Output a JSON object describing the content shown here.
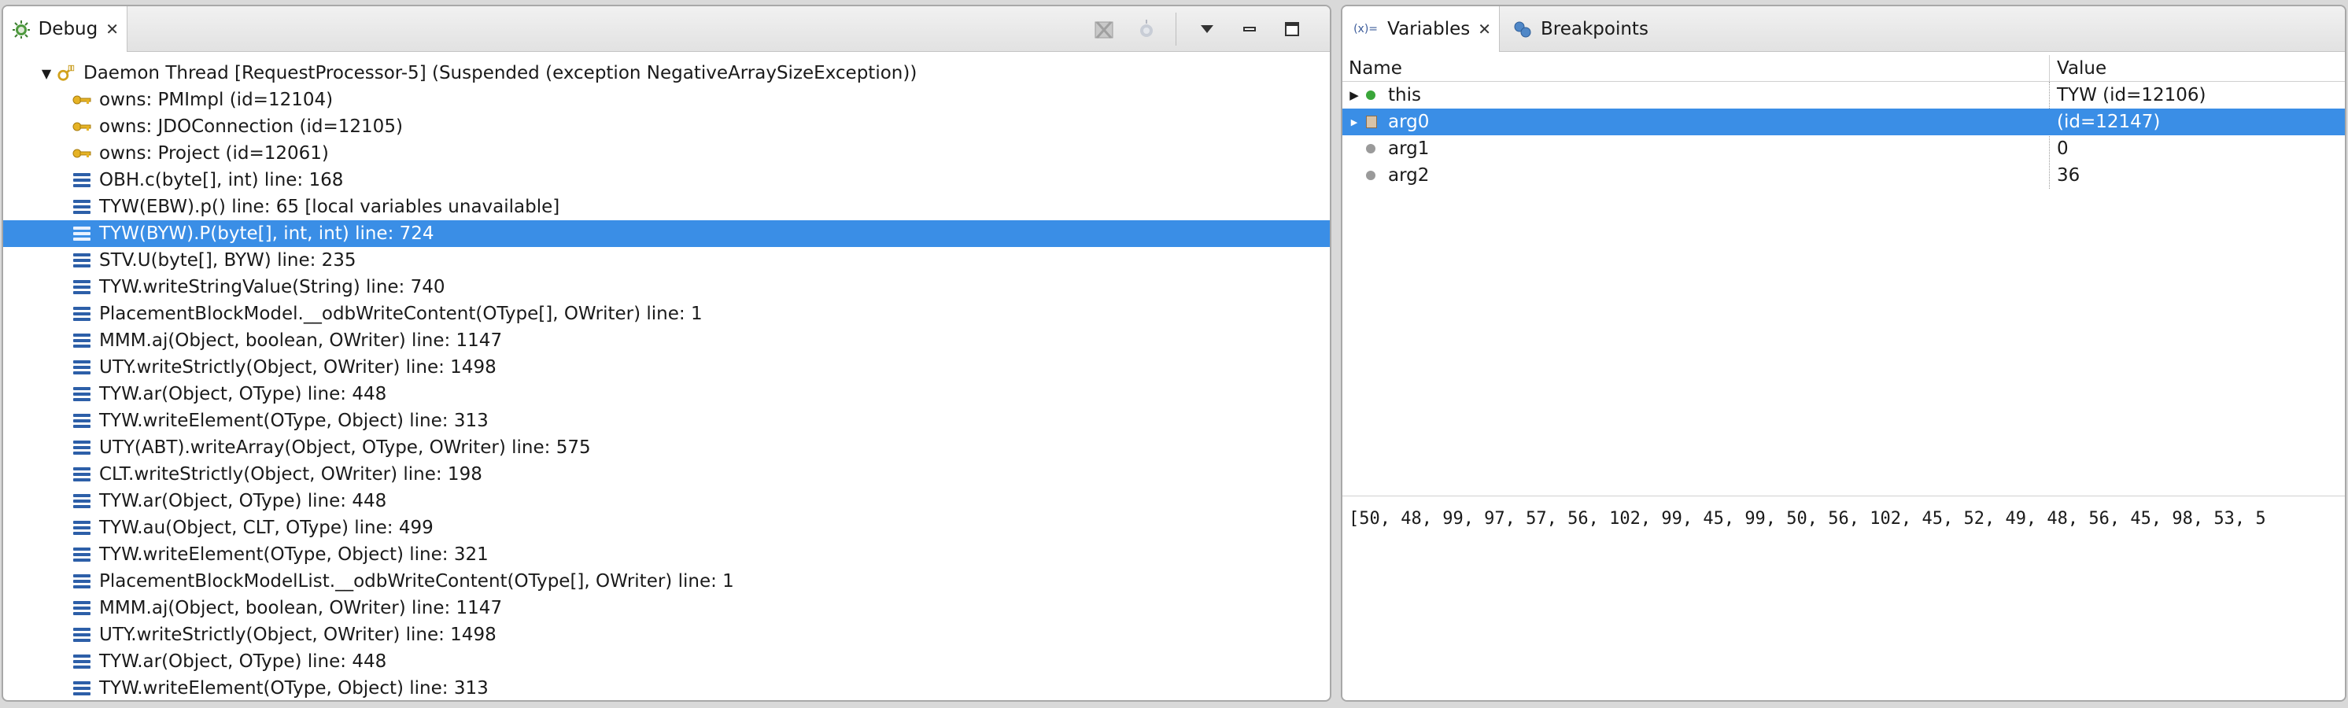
{
  "debug": {
    "tab_label": "Debug",
    "close_glyph": "✕",
    "tree": {
      "thread": "Daemon Thread [RequestProcessor-5] (Suspended (exception NegativeArraySizeException))",
      "monitors": [
        "owns: PMImpl  (id=12104)",
        "owns: JDOConnection  (id=12105)",
        "owns: Project  (id=12061)"
      ],
      "frames": [
        "OBH.c(byte[], int) line: 168",
        "TYW(EBW).p() line: 65 [local variables unavailable]",
        "TYW(BYW).P(byte[], int, int) line: 724",
        "STV.U(byte[], BYW) line: 235",
        "TYW.writeStringValue(String) line: 740",
        "PlacementBlockModel.__odbWriteContent(OType[], OWriter) line: 1",
        "MMM.aj(Object, boolean, OWriter) line: 1147",
        "UTY.writeStrictly(Object, OWriter) line: 1498",
        "TYW.ar(Object, OType) line: 448",
        "TYW.writeElement(OType, Object) line: 313",
        "UTY(ABT).writeArray(Object, OType, OWriter) line: 575",
        "CLT.writeStrictly(Object, OWriter) line: 198",
        "TYW.ar(Object, OType) line: 448",
        "TYW.au(Object, CLT, OType) line: 499",
        "TYW.writeElement(OType, Object) line: 321",
        "PlacementBlockModelList.__odbWriteContent(OType[], OWriter) line: 1",
        "MMM.aj(Object, boolean, OWriter) line: 1147",
        "UTY.writeStrictly(Object, OWriter) line: 1498",
        "TYW.ar(Object, OType) line: 448",
        "TYW.writeElement(OType, Object) line: 313"
      ],
      "selected_frame": 2
    }
  },
  "variables": {
    "tab_label": "Variables",
    "tab_prefix": "(x)=",
    "breakpoints_tab_label": "Breakpoints",
    "close_glyph": "✕",
    "col_name": "Name",
    "col_value": "Value",
    "rows": [
      {
        "name": "this",
        "value": "TYW  (id=12106)",
        "expandable": true,
        "dot_color": "#3aa63a"
      },
      {
        "name": "arg0",
        "value": "(id=12147)",
        "expandable": true,
        "dot_color": "#8f8f8f"
      },
      {
        "name": "arg1",
        "value": "0",
        "expandable": false,
        "dot_color": "#9a9a9a"
      },
      {
        "name": "arg2",
        "value": "36",
        "expandable": false,
        "dot_color": "#9a9a9a"
      }
    ],
    "selected_row": 1,
    "detail_text": "[50, 48, 99, 97, 57, 56, 102, 99, 45, 99, 50, 56, 102, 45, 52, 49, 48, 56, 45, 98, 53, 5"
  },
  "colors": {
    "selection": "#3a8ee6",
    "stack_icon": "#2d5fa8",
    "key_icon": "#d2a21c"
  }
}
